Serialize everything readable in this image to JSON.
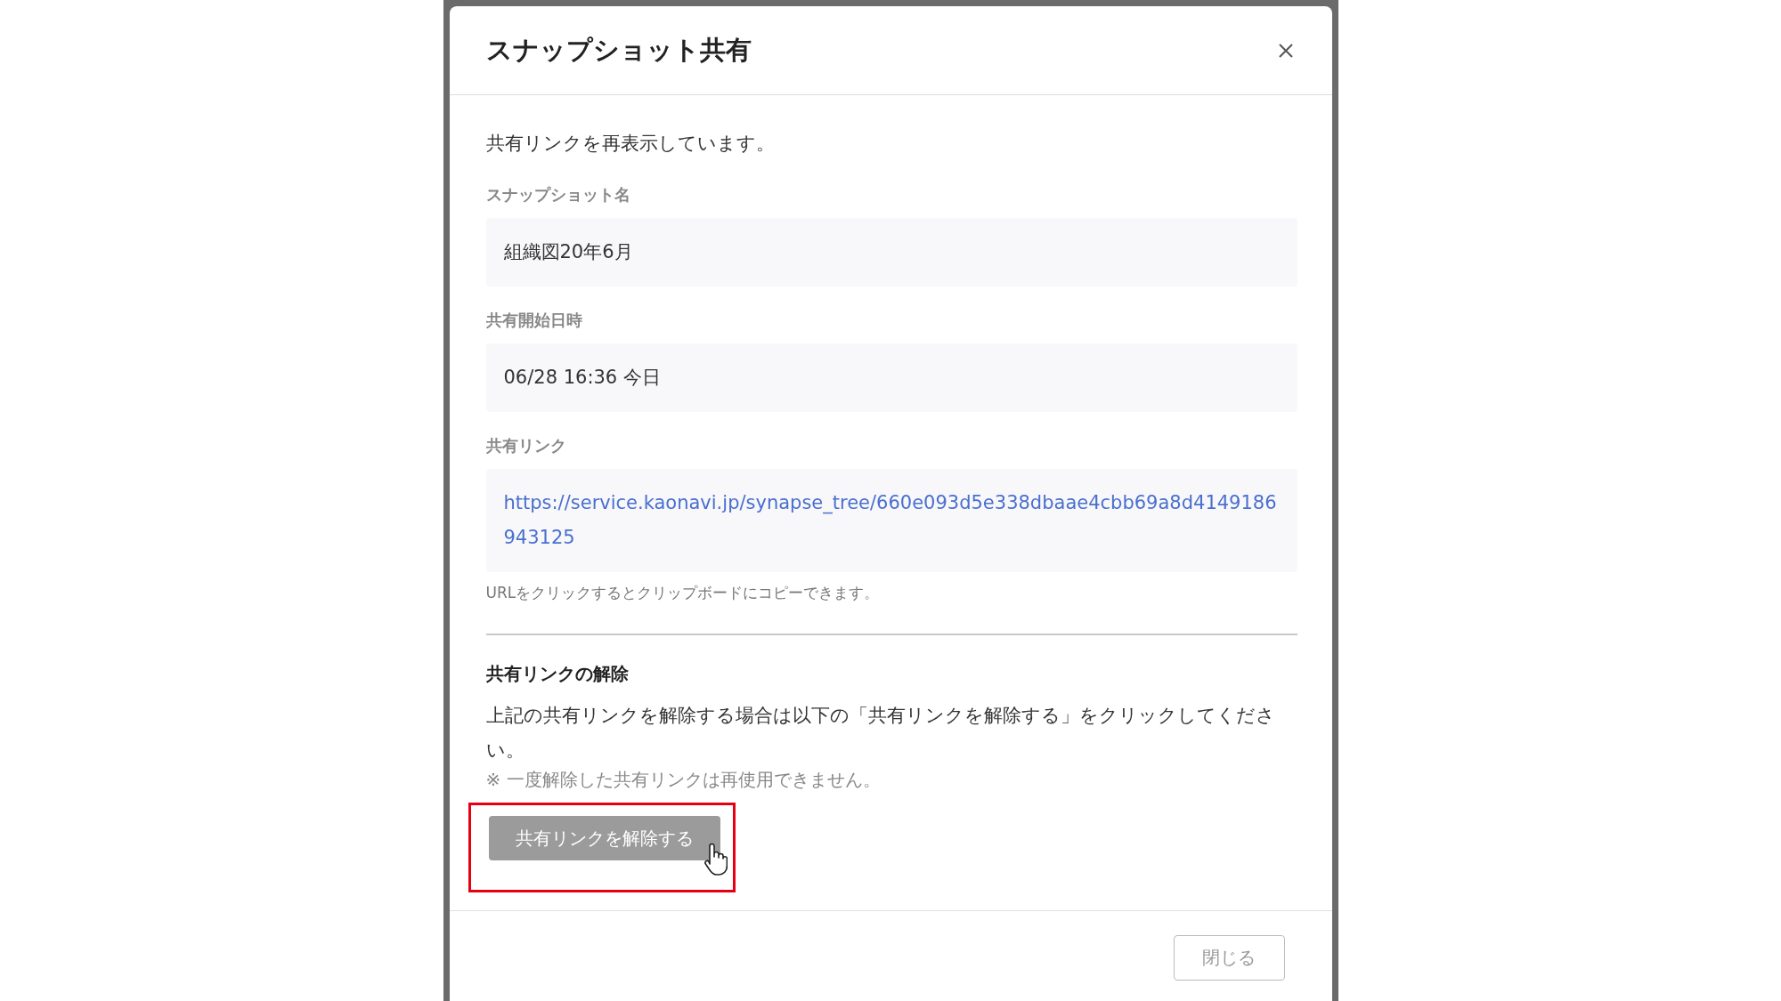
{
  "dialog": {
    "title": "スナップショット共有",
    "intro": "共有リンクを再表示しています。",
    "fields": [
      {
        "label": "スナップショット名",
        "value": "組織図20年6月",
        "kind": "text"
      },
      {
        "label": "共有開始日時",
        "value": "06/28 16:36 今日",
        "kind": "text"
      },
      {
        "label": "共有リンク",
        "value": "https://service.kaonavi.jp/synapse_tree/660e093d5e338dbaae4cbb69a8d4149186943125",
        "kind": "link"
      }
    ],
    "link_hint": "URLをクリックするとクリップボードにコピーできます。",
    "release": {
      "heading": "共有リンクの解除",
      "description": "上記の共有リンクを解除する場合は以下の「共有リンクを解除する」をクリックしてください。",
      "note": "※ 一度解除した共有リンクは再使用できません。",
      "button": "共有リンクを解除する",
      "highlighted": true
    },
    "footer": {
      "close_button": "閉じる"
    }
  }
}
